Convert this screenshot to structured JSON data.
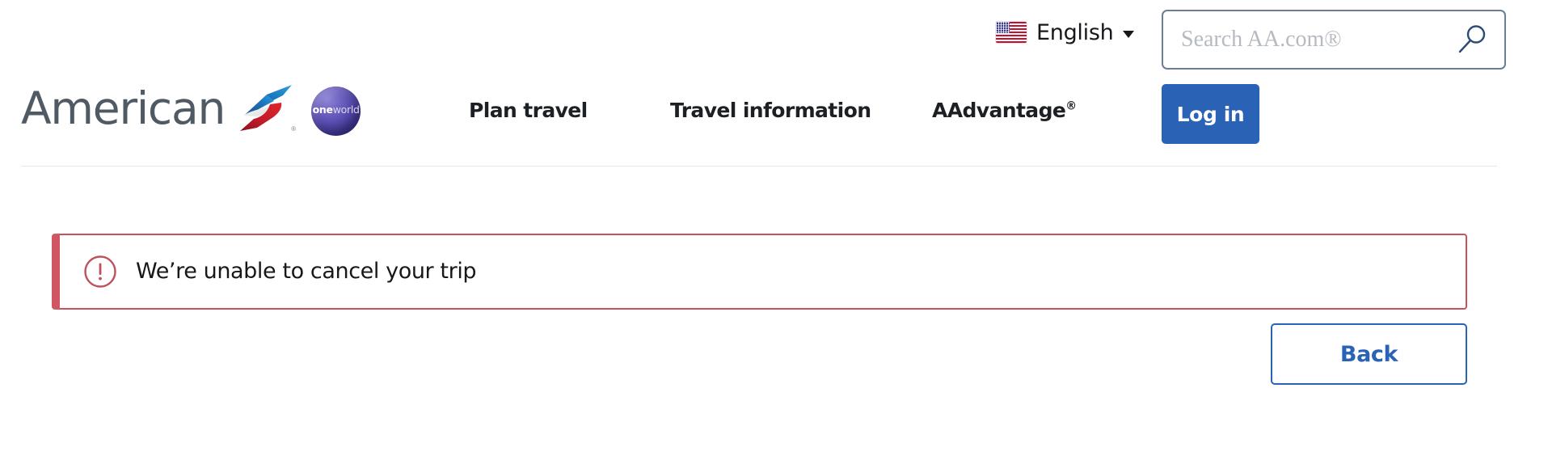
{
  "header": {
    "logo": {
      "wordmark": "American",
      "flight_symbol_name": "american-airlines-flight-symbol",
      "alliance": {
        "prefix": "one",
        "suffix": "world"
      }
    },
    "nav": [
      {
        "label": "Plan travel",
        "name": "nav-plan-travel"
      },
      {
        "label": "Travel information",
        "name": "nav-travel-information"
      },
      {
        "label": "AAdvantage",
        "trademark": "®",
        "name": "nav-aadvantage"
      }
    ],
    "login_label": "Log in",
    "language": {
      "label": "English",
      "flag": "us-flag-icon",
      "caret": "chevron-down-icon"
    },
    "search": {
      "value": "",
      "placeholder": "Search AA.com®",
      "icon": "magnifier-icon"
    }
  },
  "main": {
    "alert": {
      "icon": "exclamation-circle-icon",
      "message": "We’re unable to cancel your trip",
      "severity": "error"
    },
    "back_label": "Back"
  },
  "colors": {
    "brand_blue": "#2a62b6",
    "alert_red": "#c9515b",
    "logo_gray": "#4f5a64",
    "oneworld_purple": "#5b4fb4",
    "divider": "#e3e7eb"
  }
}
